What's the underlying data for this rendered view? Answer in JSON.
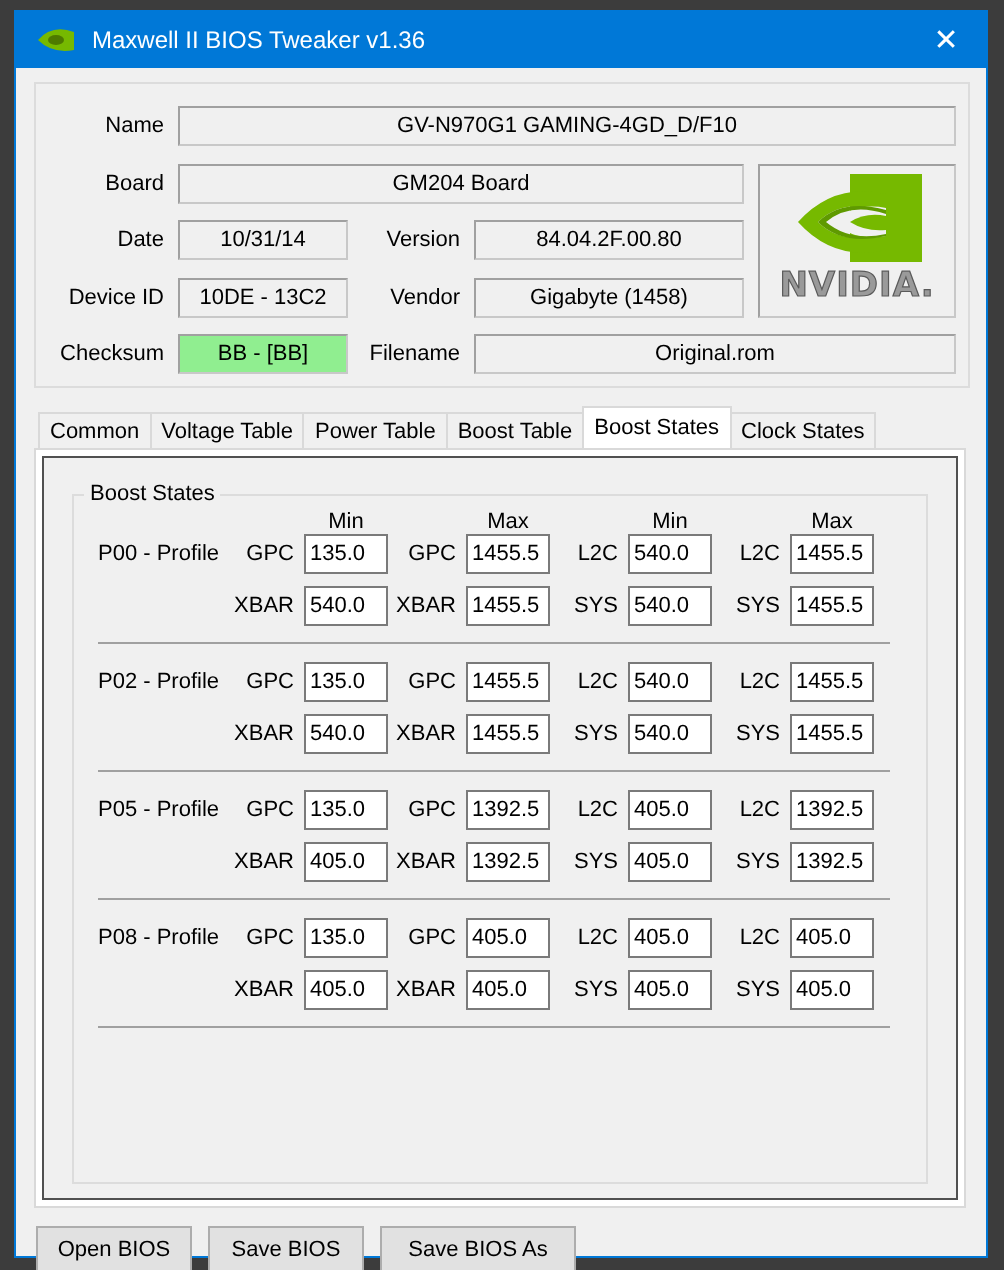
{
  "window": {
    "title": "Maxwell II BIOS Tweaker v1.36",
    "close": "✕"
  },
  "info": {
    "name": {
      "label": "Name",
      "value": "GV-N970G1 GAMING-4GD_D/F10"
    },
    "board": {
      "label": "Board",
      "value": "GM204 Board"
    },
    "date": {
      "label": "Date",
      "value": "10/31/14"
    },
    "version": {
      "label": "Version",
      "value": "84.04.2F.00.80"
    },
    "device_id": {
      "label": "Device ID",
      "value": "10DE - 13C2"
    },
    "vendor": {
      "label": "Vendor",
      "value": "Gigabyte (1458)"
    },
    "checksum": {
      "label": "Checksum",
      "value": "BB - [BB]",
      "valid": true
    },
    "filename": {
      "label": "Filename",
      "value": "Original.rom"
    },
    "logo": {
      "text": "NVIDIA."
    }
  },
  "tabs": [
    {
      "label": "Common",
      "selected": false
    },
    {
      "label": "Voltage Table",
      "selected": false
    },
    {
      "label": "Power Table",
      "selected": false
    },
    {
      "label": "Boost Table",
      "selected": false
    },
    {
      "label": "Boost States",
      "selected": true
    },
    {
      "label": "Clock States",
      "selected": false
    }
  ],
  "boost_states": {
    "title": "Boost States",
    "headers": [
      "Min",
      "Max",
      "Min",
      "Max"
    ],
    "profiles": [
      {
        "name": "P00 - Profile",
        "rows": [
          [
            {
              "label": "GPC",
              "value": "135.0"
            },
            {
              "label": "GPC",
              "value": "1455.5"
            },
            {
              "label": "L2C",
              "value": "540.0"
            },
            {
              "label": "L2C",
              "value": "1455.5"
            }
          ],
          [
            {
              "label": "XBAR",
              "value": "540.0"
            },
            {
              "label": "XBAR",
              "value": "1455.5"
            },
            {
              "label": "SYS",
              "value": "540.0"
            },
            {
              "label": "SYS",
              "value": "1455.5"
            }
          ]
        ]
      },
      {
        "name": "P02 - Profile",
        "rows": [
          [
            {
              "label": "GPC",
              "value": "135.0"
            },
            {
              "label": "GPC",
              "value": "1455.5"
            },
            {
              "label": "L2C",
              "value": "540.0"
            },
            {
              "label": "L2C",
              "value": "1455.5"
            }
          ],
          [
            {
              "label": "XBAR",
              "value": "540.0"
            },
            {
              "label": "XBAR",
              "value": "1455.5"
            },
            {
              "label": "SYS",
              "value": "540.0"
            },
            {
              "label": "SYS",
              "value": "1455.5"
            }
          ]
        ]
      },
      {
        "name": "P05 - Profile",
        "rows": [
          [
            {
              "label": "GPC",
              "value": "135.0"
            },
            {
              "label": "GPC",
              "value": "1392.5"
            },
            {
              "label": "L2C",
              "value": "405.0"
            },
            {
              "label": "L2C",
              "value": "1392.5"
            }
          ],
          [
            {
              "label": "XBAR",
              "value": "405.0"
            },
            {
              "label": "XBAR",
              "value": "1392.5"
            },
            {
              "label": "SYS",
              "value": "405.0"
            },
            {
              "label": "SYS",
              "value": "1392.5"
            }
          ]
        ]
      },
      {
        "name": "P08 - Profile",
        "rows": [
          [
            {
              "label": "GPC",
              "value": "135.0"
            },
            {
              "label": "GPC",
              "value": "405.0"
            },
            {
              "label": "L2C",
              "value": "405.0"
            },
            {
              "label": "L2C",
              "value": "405.0"
            }
          ],
          [
            {
              "label": "XBAR",
              "value": "405.0"
            },
            {
              "label": "XBAR",
              "value": "405.0"
            },
            {
              "label": "SYS",
              "value": "405.0"
            },
            {
              "label": "SYS",
              "value": "405.0"
            }
          ]
        ]
      }
    ]
  },
  "buttons": [
    "Open BIOS",
    "Save BIOS",
    "Save BIOS As"
  ]
}
